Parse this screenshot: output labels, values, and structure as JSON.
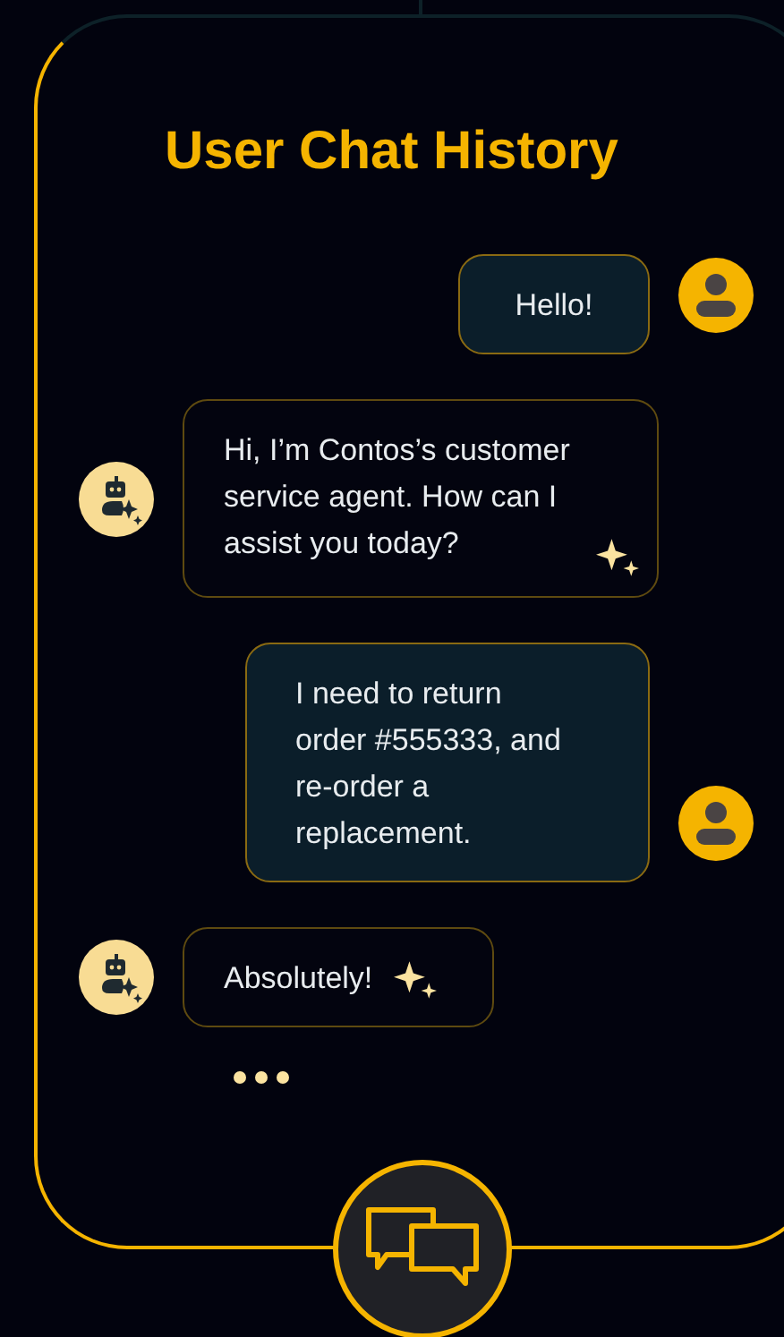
{
  "title": "User Chat History",
  "messages": [
    {
      "kind": "user",
      "text": "Hello!"
    },
    {
      "kind": "bot",
      "text": "Hi, I’m Contos’s customer service agent. How can I assist you today?"
    },
    {
      "kind": "user",
      "text": "I need to return order #555333, and re-order a replacement."
    },
    {
      "kind": "bot",
      "text": "Absolutely!"
    }
  ],
  "typing": true
}
